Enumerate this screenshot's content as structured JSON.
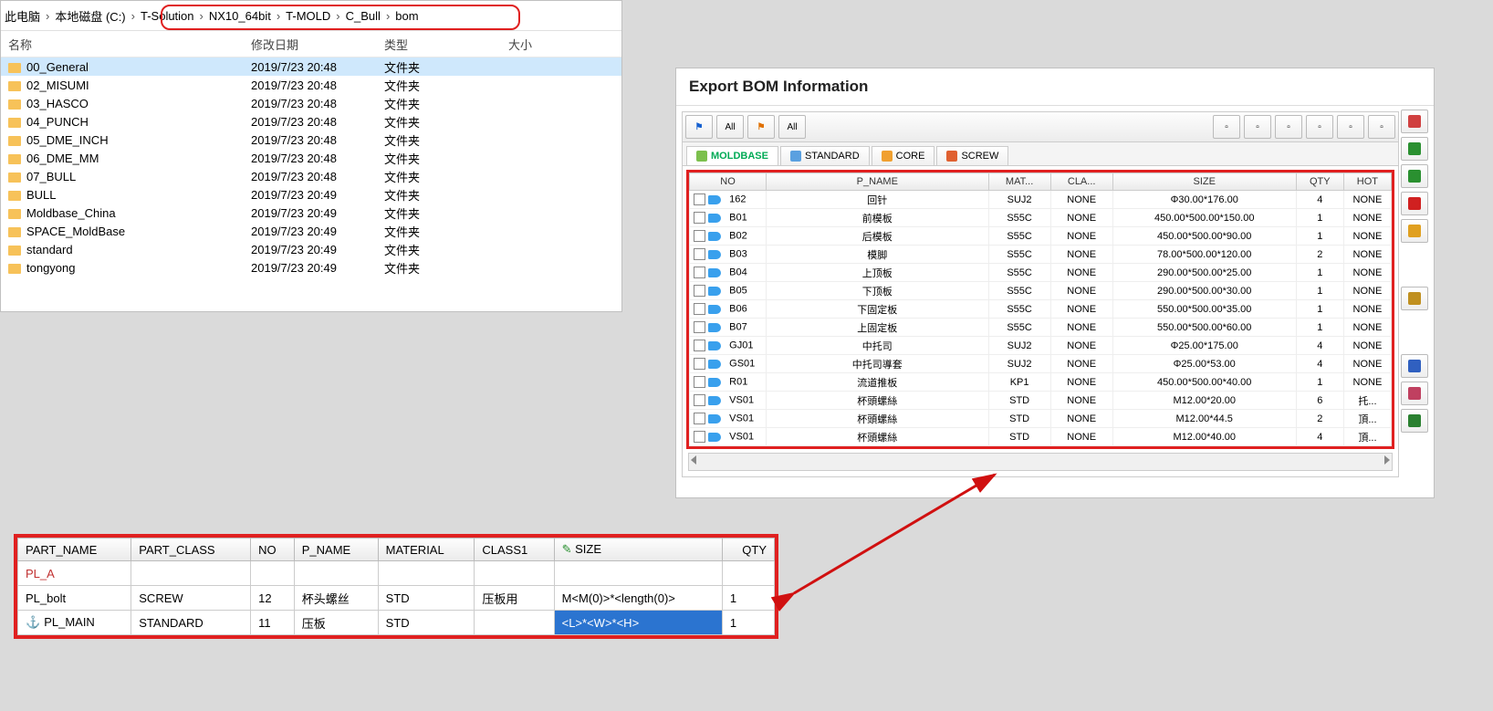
{
  "breadcrumb": {
    "items": [
      "此电脑",
      "本地磁盘 (C:)",
      "T-Solution",
      "NX10_64bit",
      "T-MOLD",
      "C_Bull",
      "bom"
    ],
    "highlight_start": 2
  },
  "explorer": {
    "columns": [
      "名称",
      "修改日期",
      "类型",
      "大小"
    ],
    "rows": [
      {
        "name": "00_General",
        "date": "2019/7/23 20:48",
        "type": "文件夹",
        "selected": true
      },
      {
        "name": "02_MISUMI",
        "date": "2019/7/23 20:48",
        "type": "文件夹"
      },
      {
        "name": "03_HASCO",
        "date": "2019/7/23 20:48",
        "type": "文件夹"
      },
      {
        "name": "04_PUNCH",
        "date": "2019/7/23 20:48",
        "type": "文件夹"
      },
      {
        "name": "05_DME_INCH",
        "date": "2019/7/23 20:48",
        "type": "文件夹"
      },
      {
        "name": "06_DME_MM",
        "date": "2019/7/23 20:48",
        "type": "文件夹"
      },
      {
        "name": "07_BULL",
        "date": "2019/7/23 20:48",
        "type": "文件夹"
      },
      {
        "name": "BULL",
        "date": "2019/7/23 20:49",
        "type": "文件夹"
      },
      {
        "name": "Moldbase_China",
        "date": "2019/7/23 20:49",
        "type": "文件夹"
      },
      {
        "name": "SPACE_MoldBase",
        "date": "2019/7/23 20:49",
        "type": "文件夹"
      },
      {
        "name": "standard",
        "date": "2019/7/23 20:49",
        "type": "文件夹"
      },
      {
        "name": "tongyong",
        "date": "2019/7/23 20:49",
        "type": "文件夹"
      }
    ]
  },
  "bom": {
    "title": "Export BOM Information",
    "toolbar_left": [
      {
        "n": "flag-blue",
        "t": "⚑"
      },
      {
        "n": "flag-all-blue",
        "t": "All"
      },
      {
        "n": "flag-orange",
        "t": "⚑"
      },
      {
        "n": "flag-all-orange",
        "t": "All"
      }
    ],
    "toolbar_right": [
      {
        "n": "export"
      },
      {
        "n": "tree"
      },
      {
        "n": "view1"
      },
      {
        "n": "view2"
      },
      {
        "n": "opt1"
      },
      {
        "n": "opt2"
      }
    ],
    "tabs": [
      {
        "label": "MOLDBASE",
        "c": "#7cc04d",
        "active": true
      },
      {
        "label": "STANDARD",
        "c": "#5aa0e0"
      },
      {
        "label": "CORE",
        "c": "#f0a030"
      },
      {
        "label": "SCREW",
        "c": "#e06030"
      }
    ],
    "columns": [
      "NO",
      "P_NAME",
      "MAT...",
      "CLA...",
      "SIZE",
      "QTY",
      "HOT"
    ],
    "rows": [
      {
        "no": "162",
        "p": "回针",
        "m": "SUJ2",
        "c": "NONE",
        "s": "Φ30.00*176.00",
        "q": "4",
        "h": "NONE"
      },
      {
        "no": "B01",
        "p": "前模板",
        "m": "S55C",
        "c": "NONE",
        "s": "450.00*500.00*150.00",
        "q": "1",
        "h": "NONE"
      },
      {
        "no": "B02",
        "p": "后模板",
        "m": "S55C",
        "c": "NONE",
        "s": "450.00*500.00*90.00",
        "q": "1",
        "h": "NONE"
      },
      {
        "no": "B03",
        "p": "模脚",
        "m": "S55C",
        "c": "NONE",
        "s": "78.00*500.00*120.00",
        "q": "2",
        "h": "NONE"
      },
      {
        "no": "B04",
        "p": "上顶板",
        "m": "S55C",
        "c": "NONE",
        "s": "290.00*500.00*25.00",
        "q": "1",
        "h": "NONE"
      },
      {
        "no": "B05",
        "p": "下顶板",
        "m": "S55C",
        "c": "NONE",
        "s": "290.00*500.00*30.00",
        "q": "1",
        "h": "NONE"
      },
      {
        "no": "B06",
        "p": "下固定板",
        "m": "S55C",
        "c": "NONE",
        "s": "550.00*500.00*35.00",
        "q": "1",
        "h": "NONE"
      },
      {
        "no": "B07",
        "p": "上固定板",
        "m": "S55C",
        "c": "NONE",
        "s": "550.00*500.00*60.00",
        "q": "1",
        "h": "NONE"
      },
      {
        "no": "GJ01",
        "p": "中托司",
        "m": "SUJ2",
        "c": "NONE",
        "s": "Φ25.00*175.00",
        "q": "4",
        "h": "NONE"
      },
      {
        "no": "GS01",
        "p": "中托司導套",
        "m": "SUJ2",
        "c": "NONE",
        "s": "Φ25.00*53.00",
        "q": "4",
        "h": "NONE"
      },
      {
        "no": "R01",
        "p": "流道推板",
        "m": "KP1",
        "c": "NONE",
        "s": "450.00*500.00*40.00",
        "q": "1",
        "h": "NONE"
      },
      {
        "no": "VS01",
        "p": "杯頭螺絲",
        "m": "STD",
        "c": "NONE",
        "s": "M12.00*20.00",
        "q": "6",
        "h": "托..."
      },
      {
        "no": "VS01",
        "p": "杯頭螺絲",
        "m": "STD",
        "c": "NONE",
        "s": "M12.00*44.5",
        "q": "2",
        "h": "頂..."
      },
      {
        "no": "VS01",
        "p": "杯頭螺絲",
        "m": "STD",
        "c": "NONE",
        "s": "M12.00*40.00",
        "q": "4",
        "h": "頂..."
      }
    ],
    "side": [
      {
        "n": "import",
        "c": "#d04040"
      },
      {
        "n": "arrow-up",
        "c": "#2a9030"
      },
      {
        "n": "arrow-down",
        "c": "#2a9030"
      },
      {
        "n": "delete",
        "c": "#d02020"
      },
      {
        "n": "save",
        "c": "#e0a020"
      },
      {
        "n": "gap"
      },
      {
        "n": "settings",
        "c": "#c09020"
      },
      {
        "n": "gap2"
      },
      {
        "n": "measure",
        "c": "#3060c0"
      },
      {
        "n": "search",
        "c": "#c04060"
      },
      {
        "n": "excel",
        "c": "#2a8030"
      }
    ]
  },
  "bottom": {
    "columns": [
      "PART_NAME",
      "PART_CLASS",
      "NO",
      "P_NAME",
      "MATERIAL",
      "CLASS1",
      "SIZE",
      "QTY"
    ],
    "size_icon": "✎",
    "rows": [
      {
        "pn": "PL_A",
        "red": true
      },
      {
        "pn": "PL_bolt",
        "pc": "SCREW",
        "no": "12",
        "p": "杯头螺丝",
        "m": "STD",
        "c": "压板用",
        "s": "M<M(0)>*<length(0)>",
        "q": "1"
      },
      {
        "pn": "PL_MAIN",
        "pc": "STANDARD",
        "no": "11",
        "p": "压板",
        "m": "STD",
        "c": "",
        "s": "<L>*<W>*<H>",
        "q": "1",
        "sel": true,
        "anchor": true
      }
    ]
  }
}
